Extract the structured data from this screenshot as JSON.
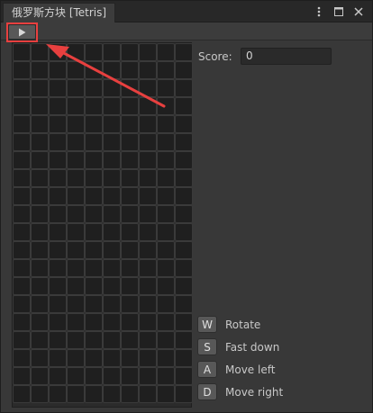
{
  "window": {
    "tab_title": "俄罗斯方块 [Tetris]"
  },
  "tab_controls": {
    "menu_icon": "kebab-icon",
    "maximize_icon": "maximize-icon",
    "close_icon": "close-icon"
  },
  "toolbar": {
    "play_icon": "play-icon"
  },
  "board": {
    "columns": 10,
    "rows": 20
  },
  "score": {
    "label": "Score:",
    "value": "0"
  },
  "controls": [
    {
      "key": "W",
      "action": "Rotate"
    },
    {
      "key": "S",
      "action": "Fast down"
    },
    {
      "key": "A",
      "action": "Move left"
    },
    {
      "key": "D",
      "action": "Move right"
    }
  ],
  "colors": {
    "highlight": "#e8403f",
    "panel": "#383838",
    "cell": "#1f1f1f"
  }
}
